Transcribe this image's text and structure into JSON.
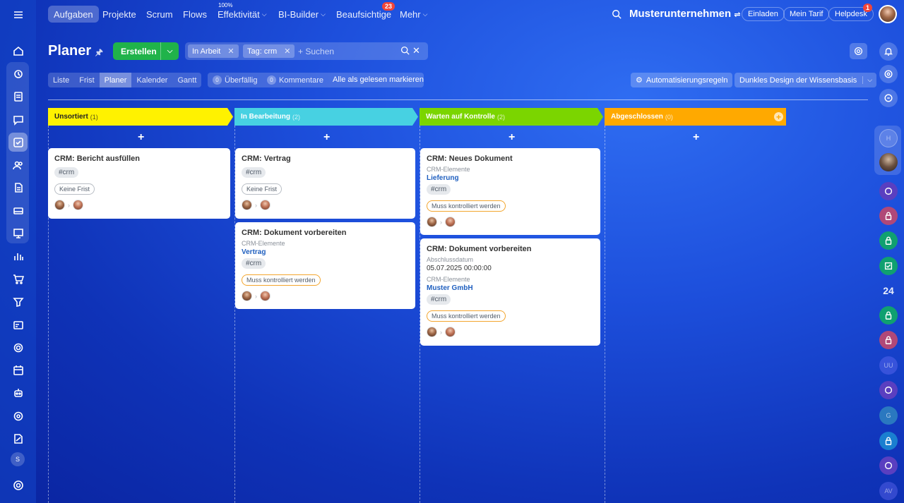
{
  "topbar": {
    "nav": [
      {
        "label": "Aufgaben"
      },
      {
        "label": "Projekte"
      },
      {
        "label": "Scrum"
      },
      {
        "label": "Flows"
      },
      {
        "label": "Effektivität",
        "sup": "100%"
      },
      {
        "label": "BI-Builder"
      },
      {
        "label": "Beaufsichtige",
        "badge": "23"
      },
      {
        "label": "Mehr"
      }
    ],
    "company": "Musterunternehmen",
    "invite": "Einladen",
    "plan": "Mein Tarif",
    "helpdesk": "Helpdesk",
    "helpdesk_badge": "1"
  },
  "header": {
    "title": "Planer",
    "create_label": "Erstellen",
    "filter_chips": [
      "In Arbeit",
      "Tag: crm"
    ],
    "search_placeholder": "+ Suchen"
  },
  "views": [
    "Liste",
    "Frist",
    "Planer",
    "Kalender",
    "Gantt"
  ],
  "active_view": "Planer",
  "counters": {
    "overdue_count": "0",
    "overdue_label": "Überfällig",
    "comments_count": "0",
    "comments_label": "Kommentare",
    "mark_read": "Alle als gelesen markieren"
  },
  "right_buttons": {
    "automation": "Automatisierungsregeln",
    "design": "Dunkles Design der Wissensbasis"
  },
  "columns": [
    {
      "title": "Unsortiert",
      "count": "(1)",
      "color": "#fff200"
    },
    {
      "title": "In Bearbeitung",
      "count": "(2)",
      "color": "#47d1e2"
    },
    {
      "title": "Warten auf Kontrolle",
      "count": "(2)",
      "color": "#7bd500"
    },
    {
      "title": "Abgeschlossen",
      "count": "(0)",
      "color": "#ffa900"
    }
  ],
  "cards": {
    "c1": {
      "title": "CRM: Bericht ausfüllen",
      "tag": "#crm",
      "status": "Keine Frist"
    },
    "c2": {
      "title": "CRM: Vertrag",
      "tag": "#crm",
      "status": "Keine Frist"
    },
    "c3": {
      "title": "CRM: Dokument vorbereiten",
      "crm_label": "CRM-Elemente",
      "crm_link": "Vertrag",
      "tag": "#crm",
      "status": "Muss kontrolliert werden"
    },
    "c4": {
      "title": "CRM: Neues Dokument",
      "crm_label": "CRM-Elemente",
      "crm_link": "Lieferung",
      "tag": "#crm",
      "status": "Muss kontrolliert werden"
    },
    "c5": {
      "title": "CRM: Dokument vorbereiten",
      "date_label": "Abschlussdatum",
      "date": "05.07.2025 00:00:00",
      "crm_label": "CRM-Elemente",
      "crm_link": "Muster GmbH",
      "tag": "#crm",
      "status": "Muss kontrolliert werden"
    }
  },
  "right_sidebar": {
    "initial_h": "H",
    "counter": "24",
    "initial_g": "G",
    "initial_uu": "UU",
    "initial_av": "AV"
  },
  "left_sidebar": {
    "initial_s": "S"
  }
}
